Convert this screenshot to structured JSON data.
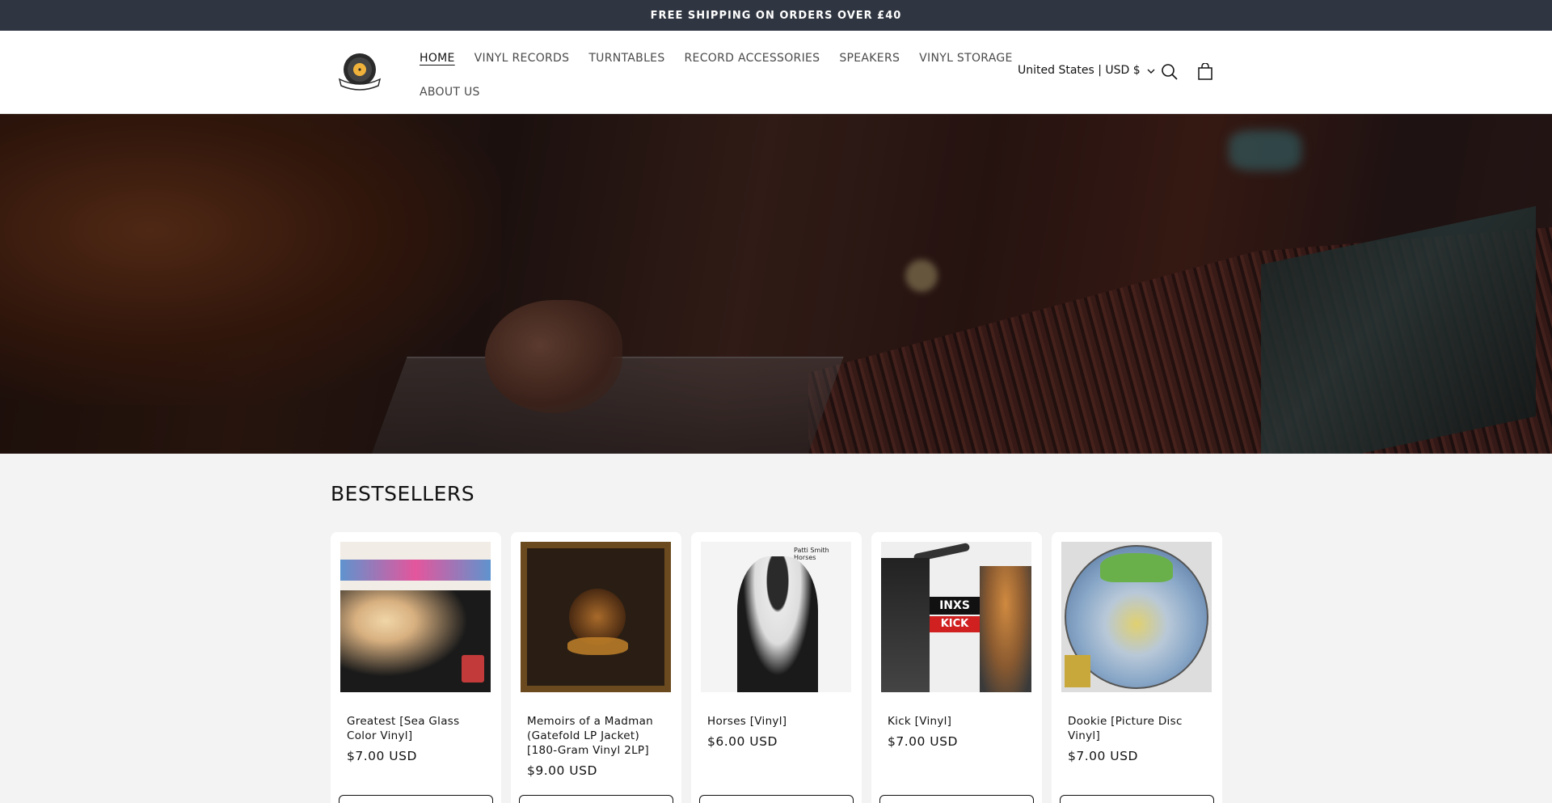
{
  "announcement": {
    "text": "FREE SHIPPING ON ORDERS OVER £40"
  },
  "header": {
    "logo_alt": "store logo",
    "nav": [
      {
        "label": "HOME",
        "active": true
      },
      {
        "label": "VINYL RECORDS"
      },
      {
        "label": "TURNTABLES"
      },
      {
        "label": "RECORD ACCESSORIES"
      },
      {
        "label": "SPEAKERS"
      },
      {
        "label": "VINYL STORAGE"
      },
      {
        "label": "ABOUT US"
      }
    ],
    "locale": "United States | USD $",
    "icons": {
      "search": "search-icon",
      "cart": "cart-icon",
      "chevron": "chevron-down-icon"
    }
  },
  "bestsellers": {
    "title": "BESTSELLERS",
    "products": [
      {
        "name": "Greatest [Sea Glass Color Vinyl]",
        "price": "$7.00 USD"
      },
      {
        "name": "Memoirs of a Madman (Gatefold LP Jacket) [180-Gram Vinyl 2LP]",
        "price": "$9.00 USD"
      },
      {
        "name": "Horses [Vinyl]",
        "price": "$6.00 USD",
        "cover_text": "Patti Smith   Horses"
      },
      {
        "name": "Kick [Vinyl]",
        "price": "$7.00 USD",
        "cover_text": [
          "INXS",
          "KICK"
        ]
      },
      {
        "name": "Dookie [Picture Disc Vinyl]",
        "price": "$7.00 USD"
      }
    ]
  },
  "colors": {
    "announcement_bg": "#303641",
    "page_bg": "#f3f3f3",
    "card_bg": "#ffffff",
    "text": "#121212"
  }
}
